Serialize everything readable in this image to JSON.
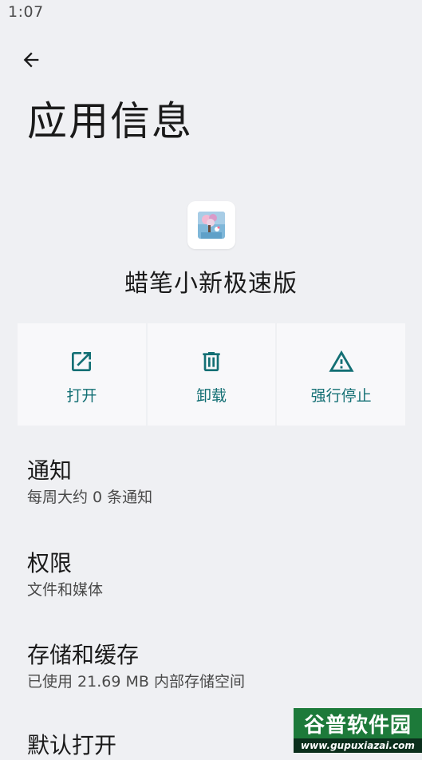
{
  "status_bar": {
    "time": "1:07"
  },
  "header": {
    "title": "应用信息"
  },
  "app": {
    "name": "蜡笔小新极速版"
  },
  "actions": [
    {
      "label": "打开",
      "icon": "open-external-icon"
    },
    {
      "label": "卸载",
      "icon": "trash-icon"
    },
    {
      "label": "强行停止",
      "icon": "warning-icon"
    }
  ],
  "settings": [
    {
      "title": "通知",
      "summary": "每周大约 0 条通知"
    },
    {
      "title": "权限",
      "summary": "文件和媒体"
    },
    {
      "title": "存储和缓存",
      "summary": "已使用 21.69 MB 内部存储空间"
    },
    {
      "title": "默认打开",
      "summary": ""
    }
  ],
  "watermark": {
    "text": "谷普软件园",
    "url": "www.gupuxiazai.com"
  },
  "colors": {
    "accent": "#136f74",
    "background": "#eff0f3",
    "card": "#f8f8fa"
  }
}
